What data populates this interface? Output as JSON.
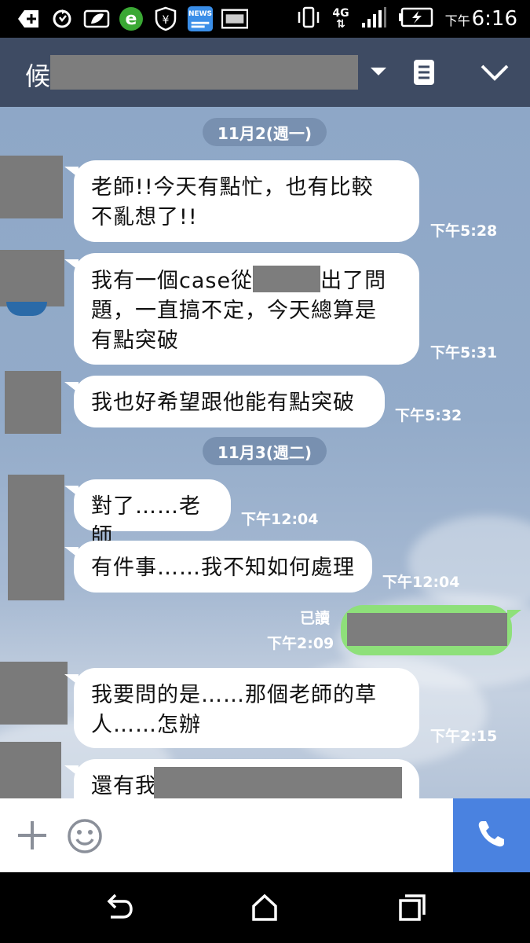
{
  "status_bar": {
    "time_prefix": "下午",
    "time": "6:16",
    "network": "4G",
    "left_icons": [
      "plus-icon",
      "sync-icon",
      "leaf-icon",
      "browser-e-icon",
      "shield-yen-icon",
      "news-icon",
      "image-icon"
    ],
    "right_icons": [
      "vibrate-icon",
      "network-4g-icon",
      "signal-icon",
      "battery-charging-icon"
    ],
    "news_label": "NEWS"
  },
  "header": {
    "title_visible_char": "候",
    "icons": [
      "dropdown-arrow-icon",
      "notes-icon",
      "collapse-chevron-icon"
    ]
  },
  "messages": [
    {
      "type": "date",
      "text": "11月2(週一)"
    },
    {
      "type": "in",
      "text_lines": [
        "老師!!今天有點忙，也有比較",
        "不亂想了!!"
      ],
      "time": "下午5:28"
    },
    {
      "type": "in",
      "text_lines": [
        "我有一個case從",
        "出了問",
        "題，一直搞不定，今天總算是",
        "有點突破"
      ],
      "time": "下午5:31"
    },
    {
      "type": "in",
      "text_lines": [
        "我也好希望跟他能有點突破"
      ],
      "time": "下午5:32"
    },
    {
      "type": "date",
      "text": "11月3(週二)"
    },
    {
      "type": "in",
      "text_lines": [
        "對了……老師"
      ],
      "time": "下午12:04"
    },
    {
      "type": "in",
      "text_lines": [
        "有件事……我不知如何處理"
      ],
      "time": "下午12:04"
    },
    {
      "type": "out",
      "read_label": "已讀",
      "time": "下午2:09"
    },
    {
      "type": "in",
      "text_lines": [
        "我要問的是……那個老師的草",
        "人……怎辦"
      ],
      "time": "下午2:15"
    },
    {
      "type": "in",
      "text_lines": [
        "還有我"
      ],
      "time": ""
    }
  ],
  "input_bar": {
    "icons": [
      "plus-icon",
      "emoji-icon",
      "phone-icon"
    ]
  },
  "nav_bar": {
    "icons": [
      "back-icon",
      "home-icon",
      "recents-icon"
    ]
  },
  "colors": {
    "header_bg": "#3e4b63",
    "date_pill": "#7890b0",
    "outgoing_bubble": "#8ee07a",
    "call_button": "#4a82e0"
  }
}
